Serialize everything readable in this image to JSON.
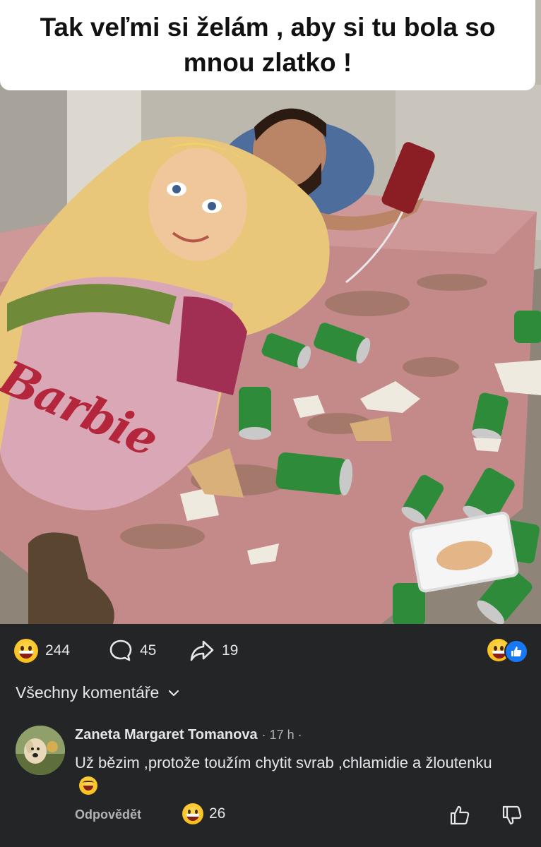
{
  "post": {
    "caption": "Tak veľmi si želám , aby si tu bola so mnou zlatko !",
    "blanket_brand": "Barbie"
  },
  "stats": {
    "reactions_count": "244",
    "comments_count": "45",
    "shares_count": "19"
  },
  "comments_section": {
    "filter_label": "Všechny komentáře"
  },
  "comment": {
    "author": "Zaneta Margaret Tomanova",
    "time": "· 17 h ·",
    "text": "Už bězim ,protože toužím chytit svrab ,chlamidie a žloutenku",
    "reply_label": "Odpovědět",
    "reaction_count": "26"
  },
  "colors": {
    "background": "#242526",
    "text_primary": "#e4e6eb",
    "text_secondary": "#b0b3b8",
    "like_blue": "#1877f2",
    "emoji_yellow": "#f7b500"
  },
  "icons": [
    "grinning-emoji-icon",
    "comment-bubble-icon",
    "share-arrow-icon",
    "like-badge-icon",
    "chevron-down-icon",
    "rofl-emoji-icon",
    "thumbs-up-icon",
    "thumbs-down-icon"
  ]
}
